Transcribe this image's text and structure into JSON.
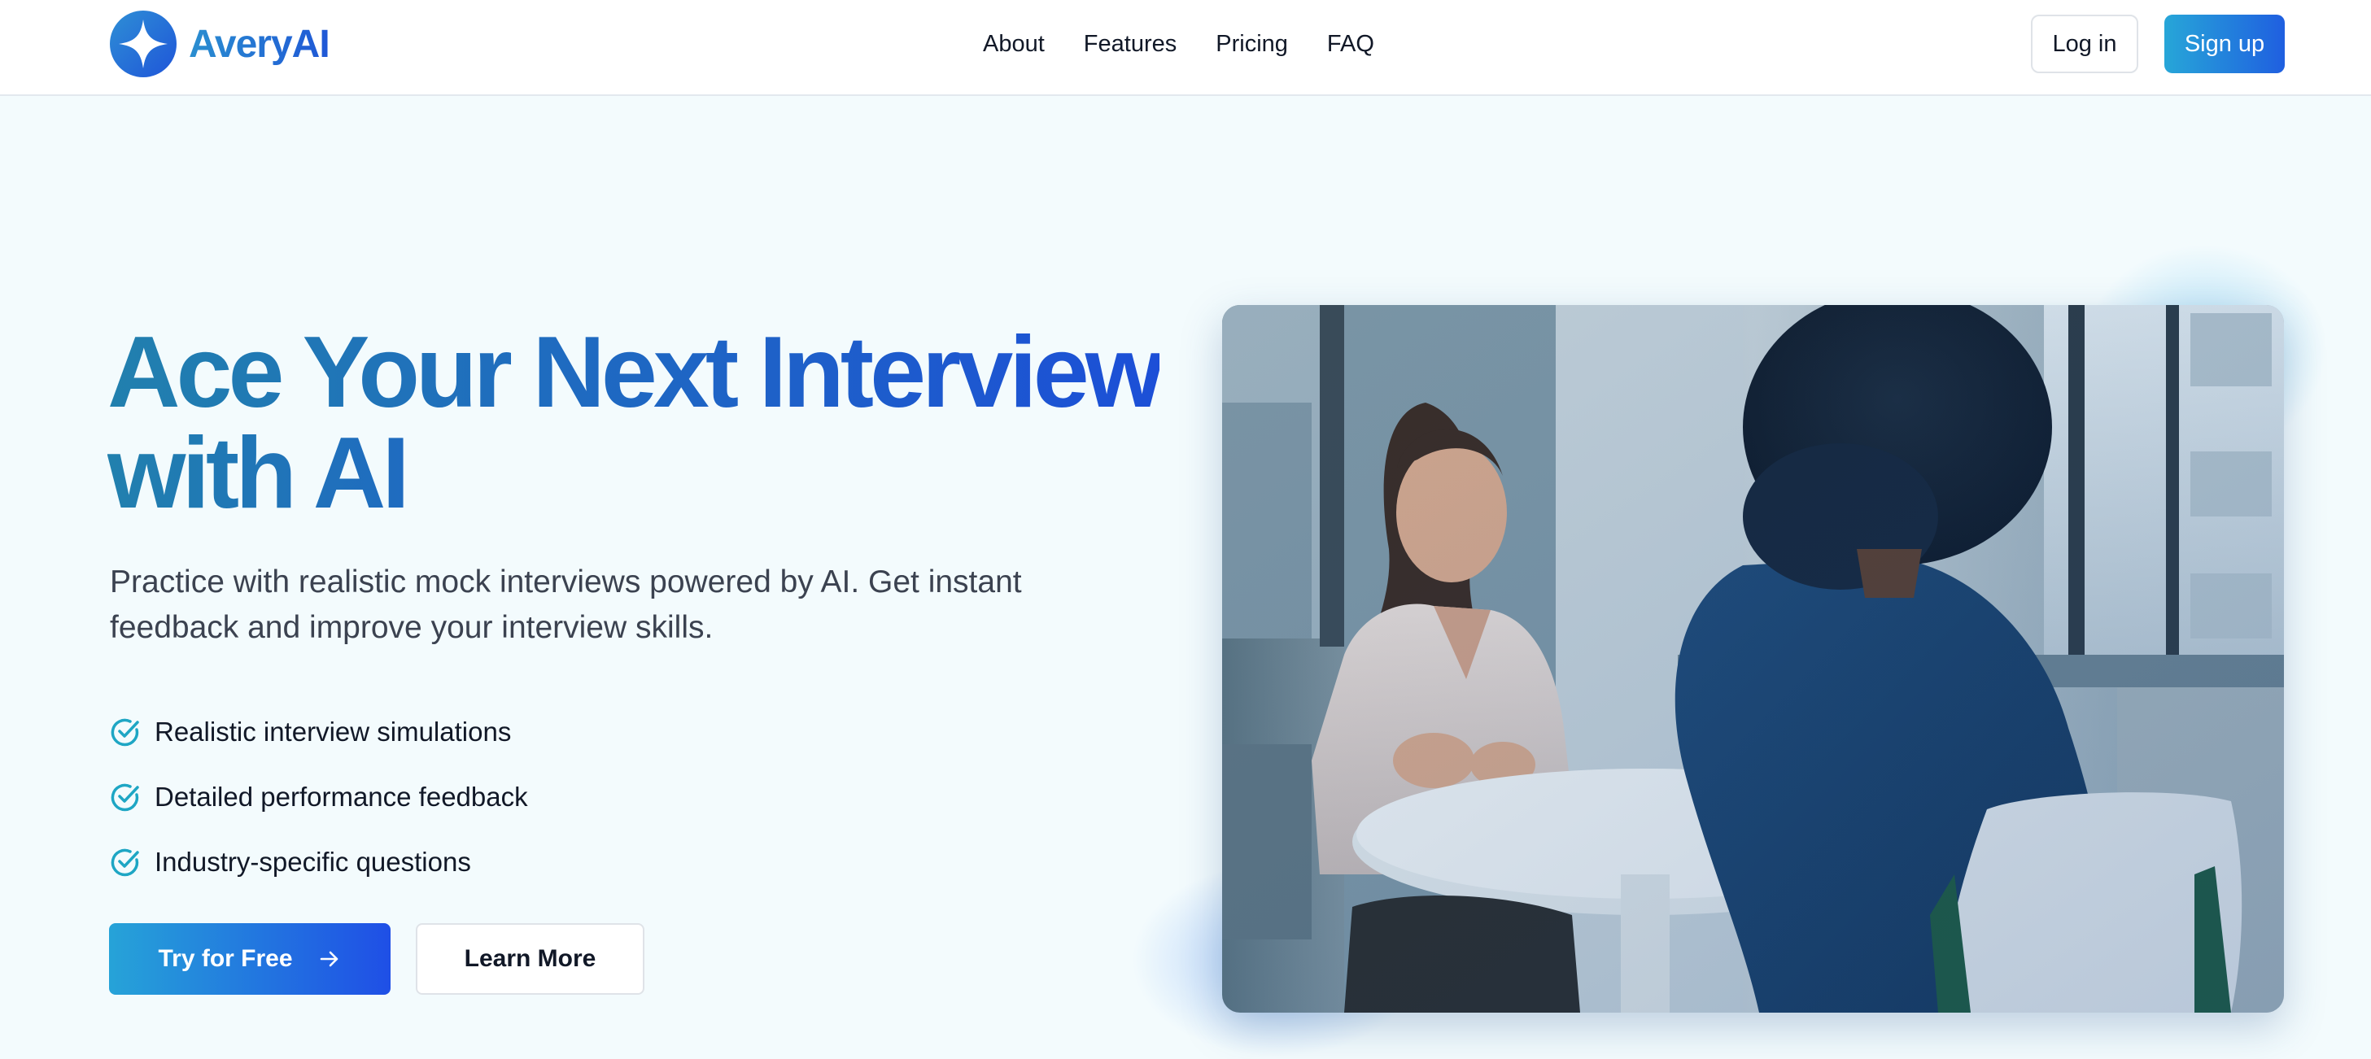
{
  "brand": {
    "name": "AveryAI",
    "logo_icon": "four-point-star-icon",
    "accent_start": "#27a6d8",
    "accent_end": "#1f4fe6"
  },
  "nav": {
    "items": [
      {
        "label": "About"
      },
      {
        "label": "Features"
      },
      {
        "label": "Pricing"
      },
      {
        "label": "FAQ"
      }
    ]
  },
  "auth": {
    "login_label": "Log in",
    "signup_label": "Sign up"
  },
  "hero": {
    "title_line1": "Ace Your Next Interview",
    "title_line2": "with AI",
    "subtitle": "Practice with realistic mock interviews powered by AI. Get instant feedback and improve your interview skills.",
    "features": [
      {
        "label": "Realistic interview simulations",
        "icon": "check-circle-icon"
      },
      {
        "label": "Detailed performance feedback",
        "icon": "check-circle-icon"
      },
      {
        "label": "Industry-specific questions",
        "icon": "check-circle-icon"
      }
    ],
    "cta_primary": "Try for Free",
    "cta_primary_icon": "arrow-right-icon",
    "cta_secondary": "Learn More",
    "image_subject": "two-people-interview-photo"
  }
}
